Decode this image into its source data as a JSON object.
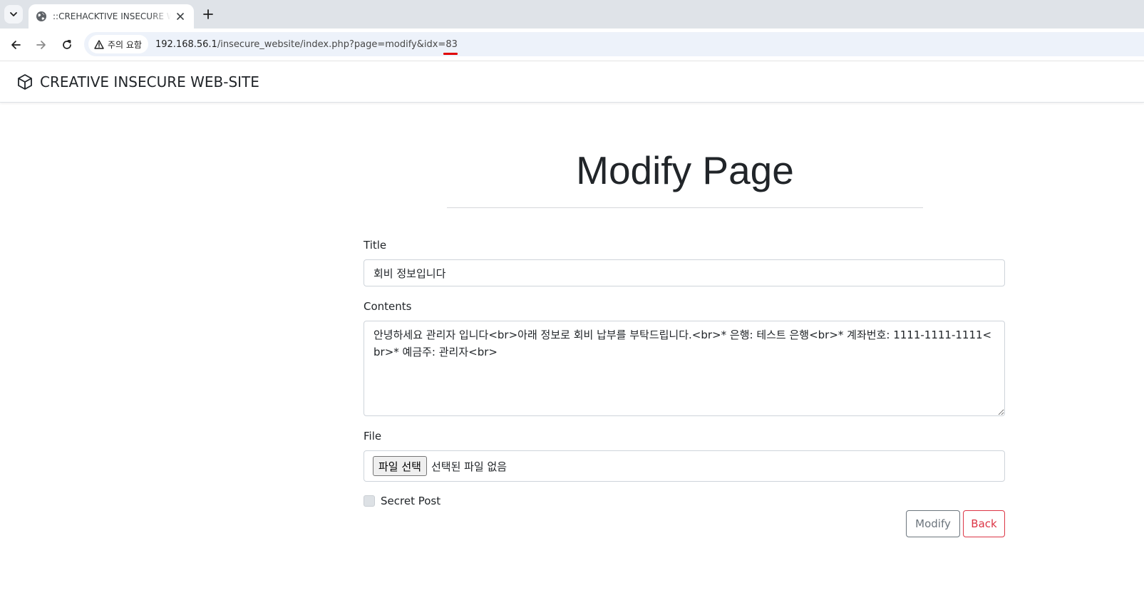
{
  "browser": {
    "tab_title": "::CREHACKTIVE INSECURE WEB-SITE::",
    "security_label": "주의 요함",
    "url_host": "192.168.56.1",
    "url_path": "/insecure_website/index.php?page=modify&idx=83"
  },
  "navbar": {
    "brand": "CREATIVE INSECURE WEB-SITE"
  },
  "page": {
    "heading": "Modify Page"
  },
  "form": {
    "title_label": "Title",
    "title_value": "회비 정보입니다",
    "contents_label": "Contents",
    "contents_value": "안녕하세요 관리자 입니다<br>아래 정보로 회비 납부를 부탁드립니다.<br>* 은행: 테스트 은행<br>* 계좌번호: 1111-1111-1111<br>* 예금주: 관리자<br>",
    "file_label": "File",
    "file_button": "파일 선택",
    "file_status": "선택된 파일 없음",
    "secret_label": "Secret Post",
    "secret_checked": false,
    "modify_button": "Modify",
    "back_button": "Back"
  },
  "colors": {
    "accent_secondary": "#6c757d",
    "accent_danger": "#dc3545",
    "omnibox_bg": "#edf2fa"
  }
}
